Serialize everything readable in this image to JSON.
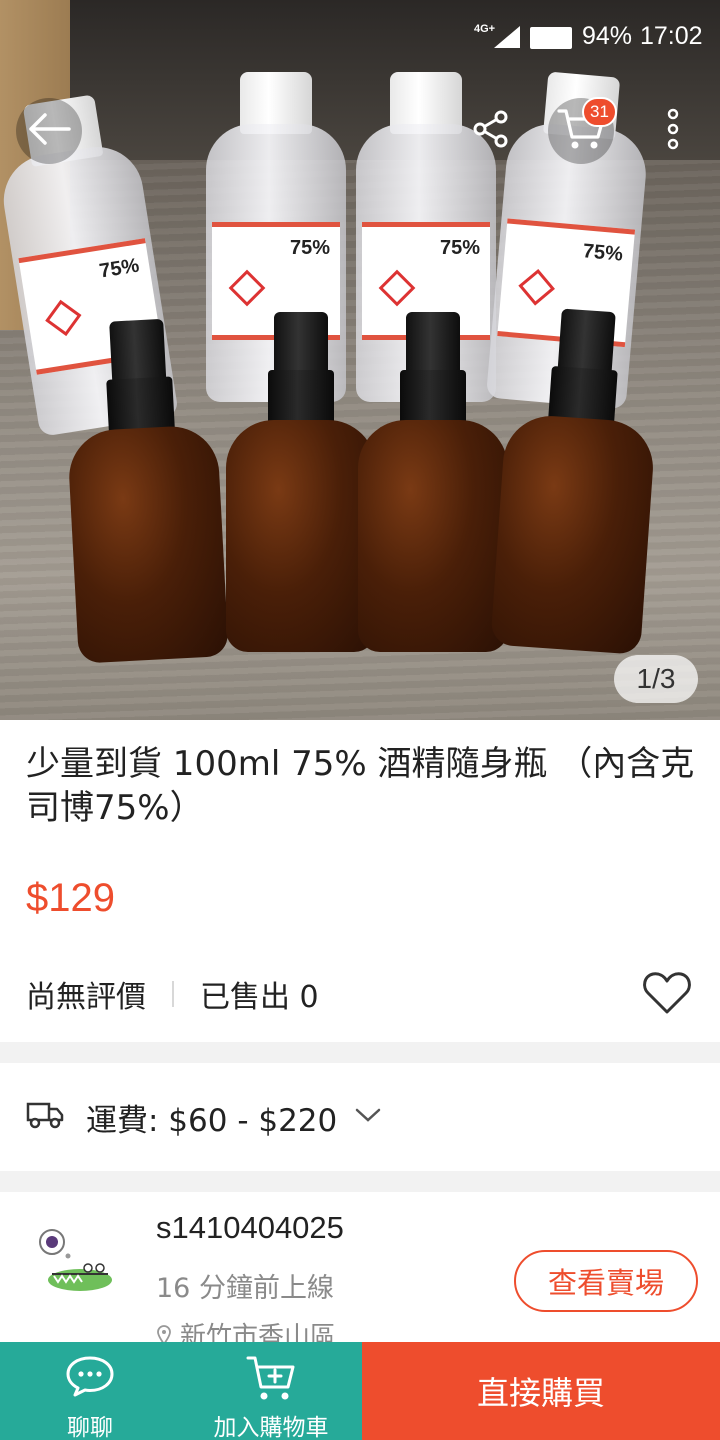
{
  "status_bar": {
    "network": "4G+",
    "battery_percent": "94%",
    "time": "17:02"
  },
  "header": {
    "back_icon": "back-arrow-icon",
    "share_icon": "share-icon",
    "cart_icon": "cart-icon",
    "cart_badge": "31",
    "more_icon": "more-vertical-icon"
  },
  "gallery": {
    "counter": "1/3",
    "current_index": 1,
    "total": 3
  },
  "product": {
    "title": "少量到貨 100ml 75% 酒精隨身瓶 （內含克司博75%）",
    "price": "$129",
    "rating_text": "尚無評價",
    "sold_text": "已售出 0"
  },
  "shipping": {
    "label": "運費: $60 - $220"
  },
  "seller": {
    "username": "s1410404025",
    "online_status": "16 分鐘前上線",
    "location": "新竹市香山區",
    "view_shop_label": "查看賣場"
  },
  "bottom_bar": {
    "chat_label": "聊聊",
    "add_to_cart_label": "加入購物車",
    "buy_now_label": "直接購買"
  },
  "colors": {
    "accent": "#ee4d2d",
    "teal": "#26aa99",
    "divider_gray": "#f2f2f2"
  }
}
